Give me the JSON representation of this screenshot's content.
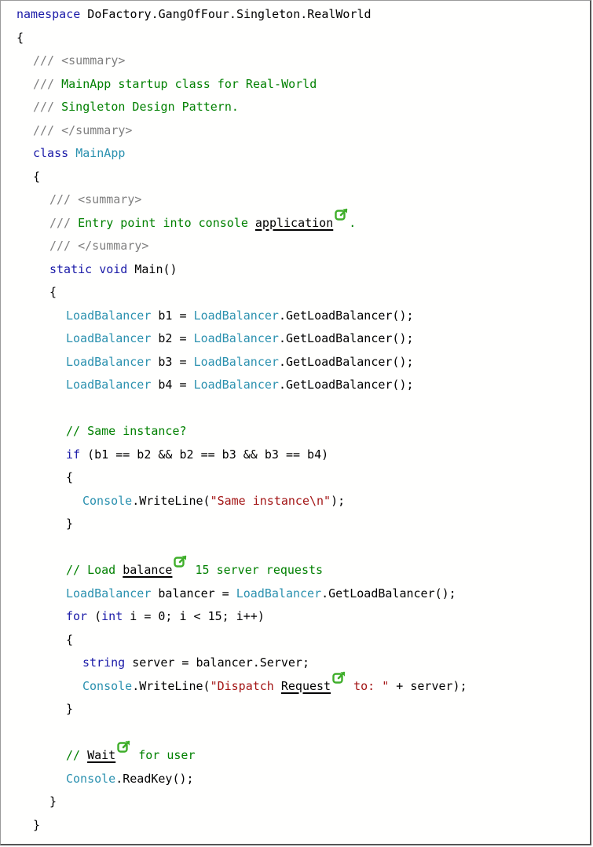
{
  "lines": [
    {
      "x": 0,
      "tokens": [
        {
          "c": "kw",
          "t": "namespace"
        },
        {
          "c": "pl",
          "t": " DoFactory.GangOfFour.Singleton.RealWorld"
        }
      ]
    },
    {
      "x": 0,
      "tokens": [
        {
          "c": "pl",
          "t": "{"
        }
      ]
    },
    {
      "x": 1,
      "tokens": [
        {
          "c": "cmg",
          "t": "/// <summary>"
        }
      ]
    },
    {
      "x": 1,
      "tokens": [
        {
          "c": "cmg",
          "t": "/// "
        },
        {
          "c": "cm",
          "t": "MainApp startup class for Real-World"
        }
      ]
    },
    {
      "x": 1,
      "tokens": [
        {
          "c": "cmg",
          "t": "/// "
        },
        {
          "c": "cm",
          "t": "Singleton Design Pattern."
        }
      ]
    },
    {
      "x": 1,
      "tokens": [
        {
          "c": "cmg",
          "t": "/// </summary>"
        }
      ]
    },
    {
      "x": 1,
      "tokens": [
        {
          "c": "kw",
          "t": "class"
        },
        {
          "c": "pl",
          "t": " "
        },
        {
          "c": "ty",
          "t": "MainApp"
        }
      ]
    },
    {
      "x": 1,
      "tokens": [
        {
          "c": "pl",
          "t": "{"
        }
      ]
    },
    {
      "x": 2,
      "tokens": [
        {
          "c": "cmg",
          "t": "/// <summary>"
        }
      ]
    },
    {
      "x": 2,
      "tokens": [
        {
          "c": "cmg",
          "t": "/// "
        },
        {
          "c": "cm",
          "t": "Entry point into console "
        },
        {
          "c": "lnk",
          "t": "application"
        },
        {
          "c": "ext",
          "t": ""
        },
        {
          "c": "cm",
          "t": "."
        }
      ]
    },
    {
      "x": 2,
      "tokens": [
        {
          "c": "cmg",
          "t": "/// </summary>"
        }
      ]
    },
    {
      "x": 2,
      "tokens": [
        {
          "c": "kw",
          "t": "static"
        },
        {
          "c": "pl",
          "t": " "
        },
        {
          "c": "kw",
          "t": "void"
        },
        {
          "c": "pl",
          "t": " Main()"
        }
      ]
    },
    {
      "x": 2,
      "tokens": [
        {
          "c": "pl",
          "t": "{"
        }
      ]
    },
    {
      "x": 3,
      "tokens": [
        {
          "c": "ty",
          "t": "LoadBalancer"
        },
        {
          "c": "pl",
          "t": " b1 = "
        },
        {
          "c": "ty",
          "t": "LoadBalancer"
        },
        {
          "c": "pl",
          "t": ".GetLoadBalancer();"
        }
      ]
    },
    {
      "x": 3,
      "tokens": [
        {
          "c": "ty",
          "t": "LoadBalancer"
        },
        {
          "c": "pl",
          "t": " b2 = "
        },
        {
          "c": "ty",
          "t": "LoadBalancer"
        },
        {
          "c": "pl",
          "t": ".GetLoadBalancer();"
        }
      ]
    },
    {
      "x": 3,
      "tokens": [
        {
          "c": "ty",
          "t": "LoadBalancer"
        },
        {
          "c": "pl",
          "t": " b3 = "
        },
        {
          "c": "ty",
          "t": "LoadBalancer"
        },
        {
          "c": "pl",
          "t": ".GetLoadBalancer();"
        }
      ]
    },
    {
      "x": 3,
      "tokens": [
        {
          "c": "ty",
          "t": "LoadBalancer"
        },
        {
          "c": "pl",
          "t": " b4 = "
        },
        {
          "c": "ty",
          "t": "LoadBalancer"
        },
        {
          "c": "pl",
          "t": ".GetLoadBalancer();"
        }
      ]
    },
    {
      "x": 3,
      "tokens": []
    },
    {
      "x": 3,
      "tokens": [
        {
          "c": "cm",
          "t": "// Same instance?"
        }
      ]
    },
    {
      "x": 3,
      "tokens": [
        {
          "c": "kw",
          "t": "if"
        },
        {
          "c": "pl",
          "t": " (b1 == b2 && b2 == b3 && b3 == b4)"
        }
      ]
    },
    {
      "x": 3,
      "tokens": [
        {
          "c": "pl",
          "t": "{"
        }
      ]
    },
    {
      "x": 4,
      "tokens": [
        {
          "c": "ty",
          "t": "Console"
        },
        {
          "c": "pl",
          "t": ".WriteLine("
        },
        {
          "c": "st",
          "t": "\"Same instance\\n\""
        },
        {
          "c": "pl",
          "t": ");"
        }
      ]
    },
    {
      "x": 3,
      "tokens": [
        {
          "c": "pl",
          "t": "}"
        }
      ]
    },
    {
      "x": 3,
      "tokens": []
    },
    {
      "x": 3,
      "tokens": [
        {
          "c": "cm",
          "t": "// Load "
        },
        {
          "c": "lnk",
          "t": "balance"
        },
        {
          "c": "ext",
          "t": ""
        },
        {
          "c": "cm",
          "t": " 15 server requests"
        }
      ]
    },
    {
      "x": 3,
      "tokens": [
        {
          "c": "ty",
          "t": "LoadBalancer"
        },
        {
          "c": "pl",
          "t": " balancer = "
        },
        {
          "c": "ty",
          "t": "LoadBalancer"
        },
        {
          "c": "pl",
          "t": ".GetLoadBalancer();"
        }
      ]
    },
    {
      "x": 3,
      "tokens": [
        {
          "c": "kw",
          "t": "for"
        },
        {
          "c": "pl",
          "t": " ("
        },
        {
          "c": "kw",
          "t": "int"
        },
        {
          "c": "pl",
          "t": " i = 0; i < 15; i++)"
        }
      ]
    },
    {
      "x": 3,
      "tokens": [
        {
          "c": "pl",
          "t": "{"
        }
      ]
    },
    {
      "x": 4,
      "tokens": [
        {
          "c": "kw",
          "t": "string"
        },
        {
          "c": "pl",
          "t": " server = balancer.Server;"
        }
      ]
    },
    {
      "x": 4,
      "tokens": [
        {
          "c": "ty",
          "t": "Console"
        },
        {
          "c": "pl",
          "t": ".WriteLine("
        },
        {
          "c": "st",
          "t": "\"Dispatch "
        },
        {
          "c": "lnk",
          "t": "Request"
        },
        {
          "c": "ext",
          "t": ""
        },
        {
          "c": "st",
          "t": " to: \""
        },
        {
          "c": "pl",
          "t": " + server);"
        }
      ]
    },
    {
      "x": 3,
      "tokens": [
        {
          "c": "pl",
          "t": "}"
        }
      ]
    },
    {
      "x": 3,
      "tokens": []
    },
    {
      "x": 3,
      "tokens": [
        {
          "c": "cm",
          "t": "// "
        },
        {
          "c": "lnk",
          "t": "Wait"
        },
        {
          "c": "ext",
          "t": ""
        },
        {
          "c": "cm",
          "t": " for user"
        }
      ]
    },
    {
      "x": 3,
      "tokens": [
        {
          "c": "ty",
          "t": "Console"
        },
        {
          "c": "pl",
          "t": ".ReadKey();"
        }
      ]
    },
    {
      "x": 2,
      "tokens": [
        {
          "c": "pl",
          "t": "}"
        }
      ]
    },
    {
      "x": 1,
      "tokens": [
        {
          "c": "pl",
          "t": "}"
        }
      ]
    }
  ]
}
